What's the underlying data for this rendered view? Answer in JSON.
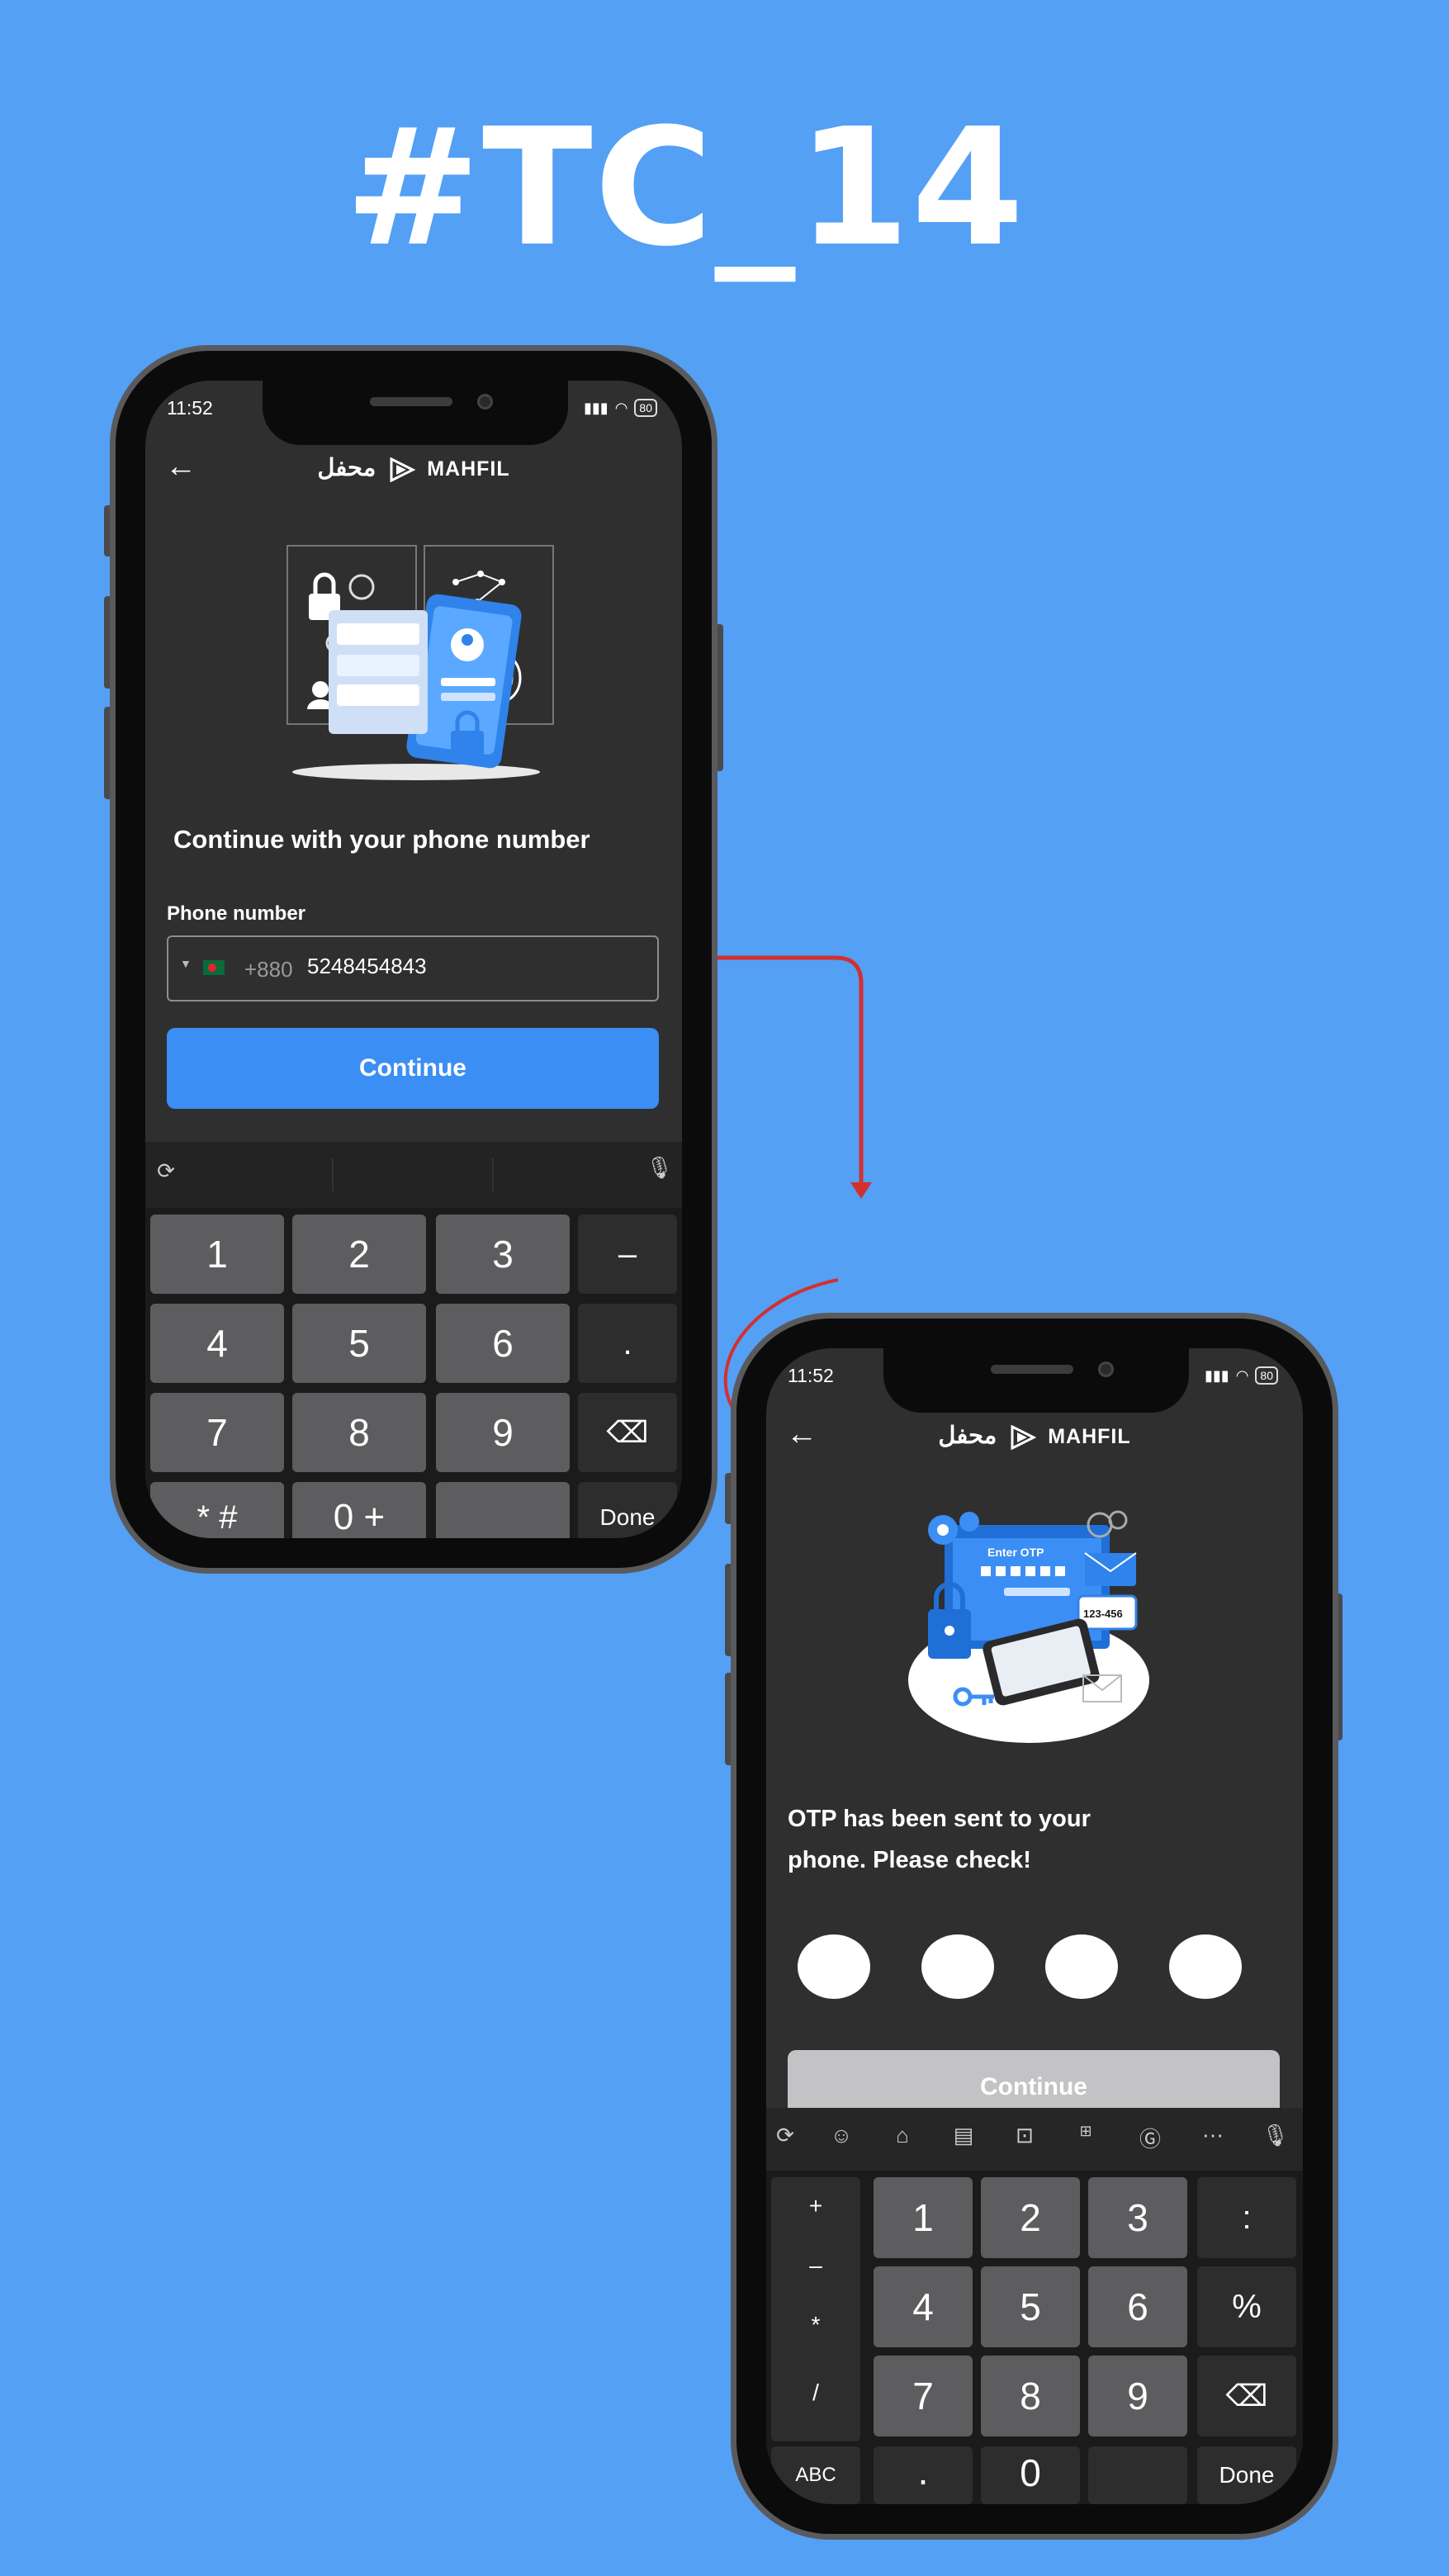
{
  "title": "#TC_14",
  "colors": {
    "background": "#53a0f5",
    "screen": "#2f2f30",
    "accent": "#3b8ef4",
    "arrow": "#d32f2f"
  },
  "phone1": {
    "status_time": "11:52",
    "battery": "80",
    "logo_arabic": "محفل",
    "logo_text": "MAHFIL",
    "headline": "Continue with your phone number",
    "phone_label": "Phone number",
    "country_code": "+880",
    "phone_value": "5248454843",
    "continue_label": "Continue",
    "keys": [
      "1",
      "2",
      "3",
      "–",
      "4",
      "5",
      "6",
      ".",
      "7",
      "8",
      "9",
      "⌫",
      "* #",
      "0 +",
      "",
      "Done"
    ]
  },
  "phone2": {
    "status_time": "11:52",
    "battery": "80",
    "logo_arabic": "محفل",
    "logo_text": "MAHFIL",
    "headline_line1": "OTP has been sent to your",
    "headline_line2": "phone. Please check!",
    "continue_label": "Continue",
    "illustration_text": "Enter OTP",
    "illustration_code": "123-456",
    "side_keys": [
      "+",
      "–",
      "*",
      "/",
      "ABC"
    ],
    "keys": [
      "1",
      "2",
      "3",
      ":",
      "4",
      "5",
      "6",
      "%",
      "7",
      "8",
      "9",
      "⌫",
      ".",
      "0",
      "",
      "Done"
    ]
  }
}
